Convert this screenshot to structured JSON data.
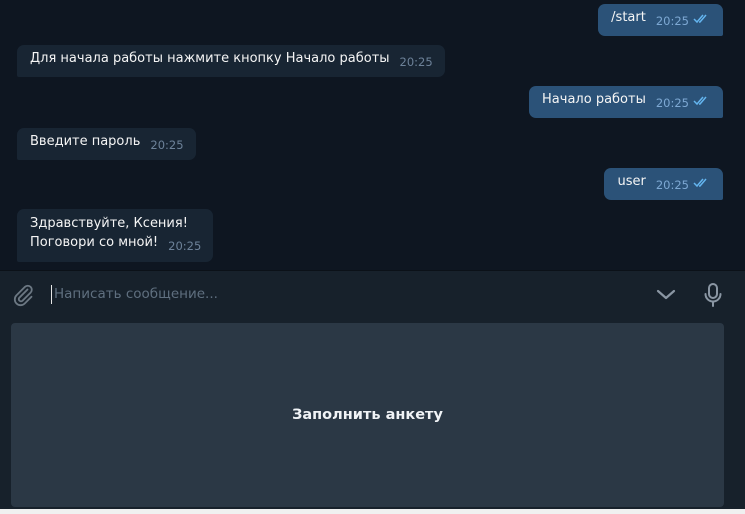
{
  "messages": [
    {
      "direction": "out",
      "text": "/start",
      "time": "20:25",
      "read": true
    },
    {
      "direction": "in",
      "text": "Для начала работы нажмите кнопку Начало работы",
      "time": "20:25"
    },
    {
      "direction": "out",
      "text": "Начало работы",
      "time": "20:25",
      "read": true
    },
    {
      "direction": "in",
      "text": "Введите пароль",
      "time": "20:25"
    },
    {
      "direction": "out",
      "text": "user",
      "time": "20:25",
      "read": true
    },
    {
      "direction": "in",
      "lines": [
        "Здравствуйте, Ксения!",
        "Поговори со мной!"
      ],
      "time": "20:25"
    }
  ],
  "composer": {
    "placeholder": "Написать сообщение...",
    "attach_icon": "paperclip-icon",
    "keyboard_toggle_icon": "chevron-down-icon",
    "voice_icon": "microphone-icon"
  },
  "reply_keyboard": {
    "buttons": [
      "Заполнить анкету"
    ]
  },
  "colors": {
    "chat_background": "#0e1621",
    "outgoing_bubble": "#2b5278",
    "incoming_bubble": "#182533",
    "panel": "#17212b",
    "keyboard_button": "#2b3845",
    "read_ticks": "#64b5ef"
  }
}
